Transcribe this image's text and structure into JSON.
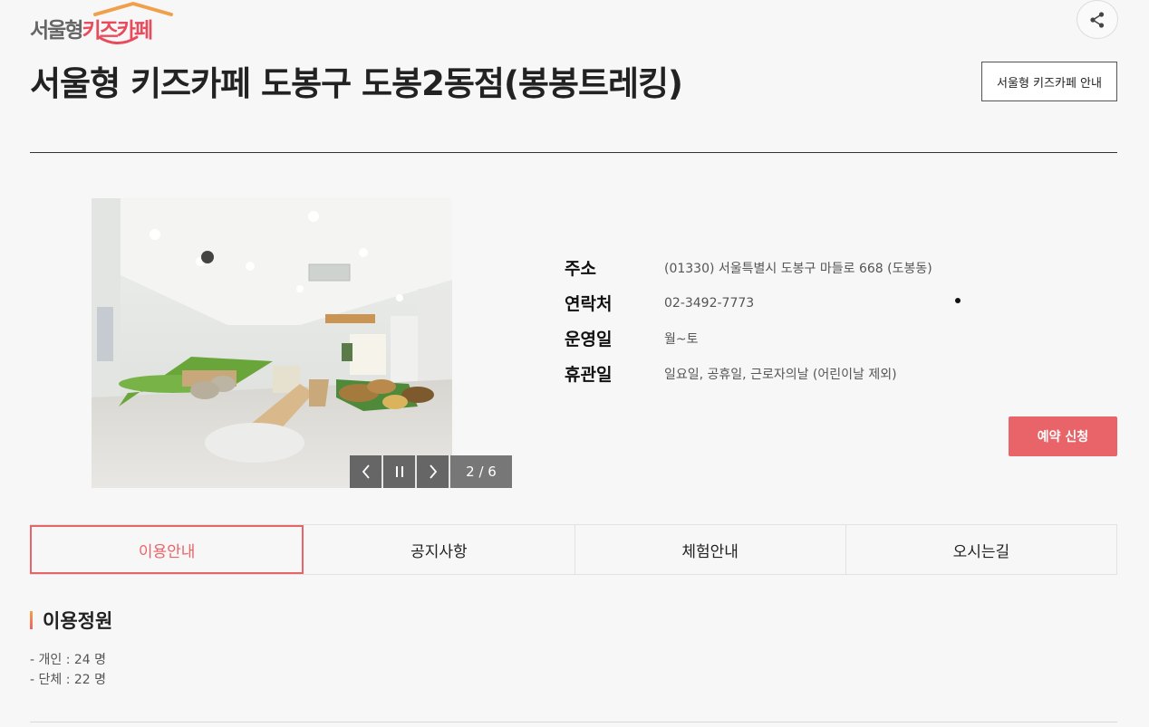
{
  "logo": {
    "text_main": "서울형",
    "text_accent": "키즈카페"
  },
  "header": {
    "title": "서울형 키즈카페 도봉구 도봉2동점(봉봉트레킹)",
    "guide_button": "서울형 키즈카페 안내",
    "share_icon": "share-icon"
  },
  "slider": {
    "counter": "2 / 6",
    "prev_icon": "chevron-left-icon",
    "pause_icon": "pause-icon",
    "next_icon": "chevron-right-icon"
  },
  "info": {
    "address_label": "주소",
    "address_value": "(01330) 서울특별시 도봉구 마들로 668 (도봉동)",
    "phone_label": "연락처",
    "phone_value": "02-3492-7773",
    "open_label": "운영일",
    "open_value": "월~토",
    "closed_label": "휴관일",
    "closed_value": "일요일, 공휴일, 근로자의날 (어린이날 제외)"
  },
  "reserve_button": "예약 신청",
  "tabs": [
    {
      "label": "이용안내",
      "active": true
    },
    {
      "label": "공지사항",
      "active": false
    },
    {
      "label": "체험안내",
      "active": false
    },
    {
      "label": "오시는길",
      "active": false
    }
  ],
  "capacity_section": {
    "title": "이용정원",
    "individual": "- 개인 : 24 명",
    "group": "- 단체 : 22 명"
  },
  "colors": {
    "accent": "#e96468",
    "logo_red": "#e84b5c",
    "logo_orange": "#f0a04b"
  }
}
